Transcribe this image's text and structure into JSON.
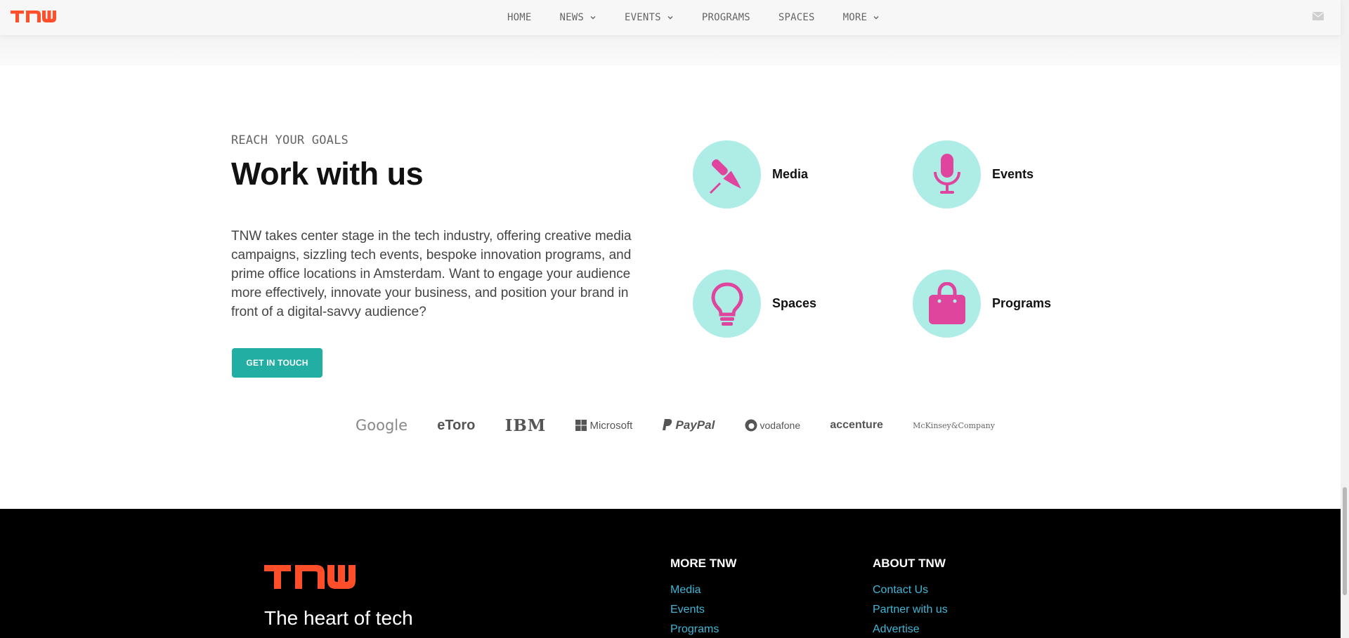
{
  "nav": {
    "items": [
      {
        "label": "HOME",
        "dropdown": false
      },
      {
        "label": "NEWS",
        "dropdown": true
      },
      {
        "label": "EVENTS",
        "dropdown": true
      },
      {
        "label": "PROGRAMS",
        "dropdown": false
      },
      {
        "label": "SPACES",
        "dropdown": false
      },
      {
        "label": "MORE",
        "dropdown": true
      }
    ]
  },
  "work": {
    "eyebrow": "REACH YOUR GOALS",
    "title": "Work with us",
    "description": "TNW takes center stage in the tech industry, offering creative media campaigns, sizzling tech events, bespoke innovation programs, and prime office locations in Amsterdam. Want to engage your audience more effectively, innovate your business, and position your brand in front of a digital-savvy audience?",
    "cta_label": "GET IN TOUCH",
    "services": [
      {
        "label": "Media",
        "icon": "pen-icon"
      },
      {
        "label": "Events",
        "icon": "microphone-icon"
      },
      {
        "label": "Spaces",
        "icon": "lightbulb-icon"
      },
      {
        "label": "Programs",
        "icon": "shopping-bag-icon"
      }
    ]
  },
  "partners": [
    "Google",
    "eToro",
    "IBM",
    "Microsoft",
    "PayPal",
    "vodafone",
    "accenture",
    "McKinsey&Company"
  ],
  "footer": {
    "tagline": "The heart of tech",
    "more_title": "MORE TNW",
    "more_links": [
      "Media",
      "Events",
      "Programs"
    ],
    "about_title": "ABOUT TNW",
    "about_links": [
      "Contact Us",
      "Partner with us",
      "Advertise"
    ]
  },
  "colors": {
    "brand": "#ff4e2a",
    "accent": "#22aea2",
    "icon_bg": "#aeede6",
    "icon_fg": "#e0459e",
    "link": "#3fb6d6"
  }
}
